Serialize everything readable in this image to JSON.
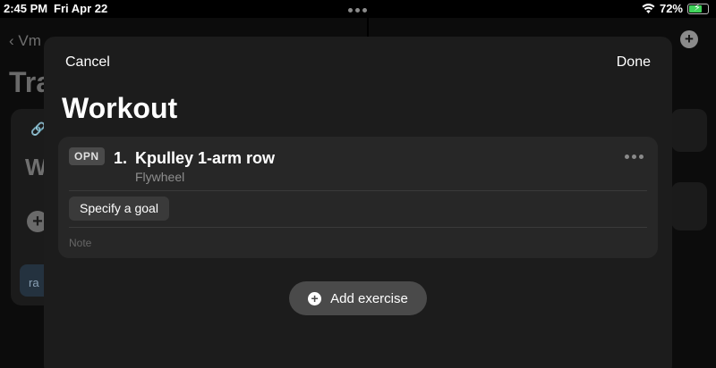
{
  "status_bar": {
    "time": "2:45 PM",
    "date": "Fri Apr 22",
    "battery": "72%",
    "battery_level": 0.72
  },
  "background": {
    "back_label": "Vm",
    "title": "Tra",
    "card_heading": "W",
    "chip_text": "ra"
  },
  "sheet": {
    "cancel_label": "Cancel",
    "done_label": "Done",
    "title": "Workout"
  },
  "exercise": {
    "badge": "OPN",
    "number": "1.",
    "name": "Kpulley 1-arm row",
    "equipment": "Flywheel",
    "goal_label": "Specify a goal",
    "note_placeholder": "Note"
  },
  "add_exercise": {
    "label": "Add exercise"
  },
  "colors": {
    "sheet_bg": "#1c1c1c",
    "card_bg": "#272727",
    "battery": "#3fd35a"
  }
}
